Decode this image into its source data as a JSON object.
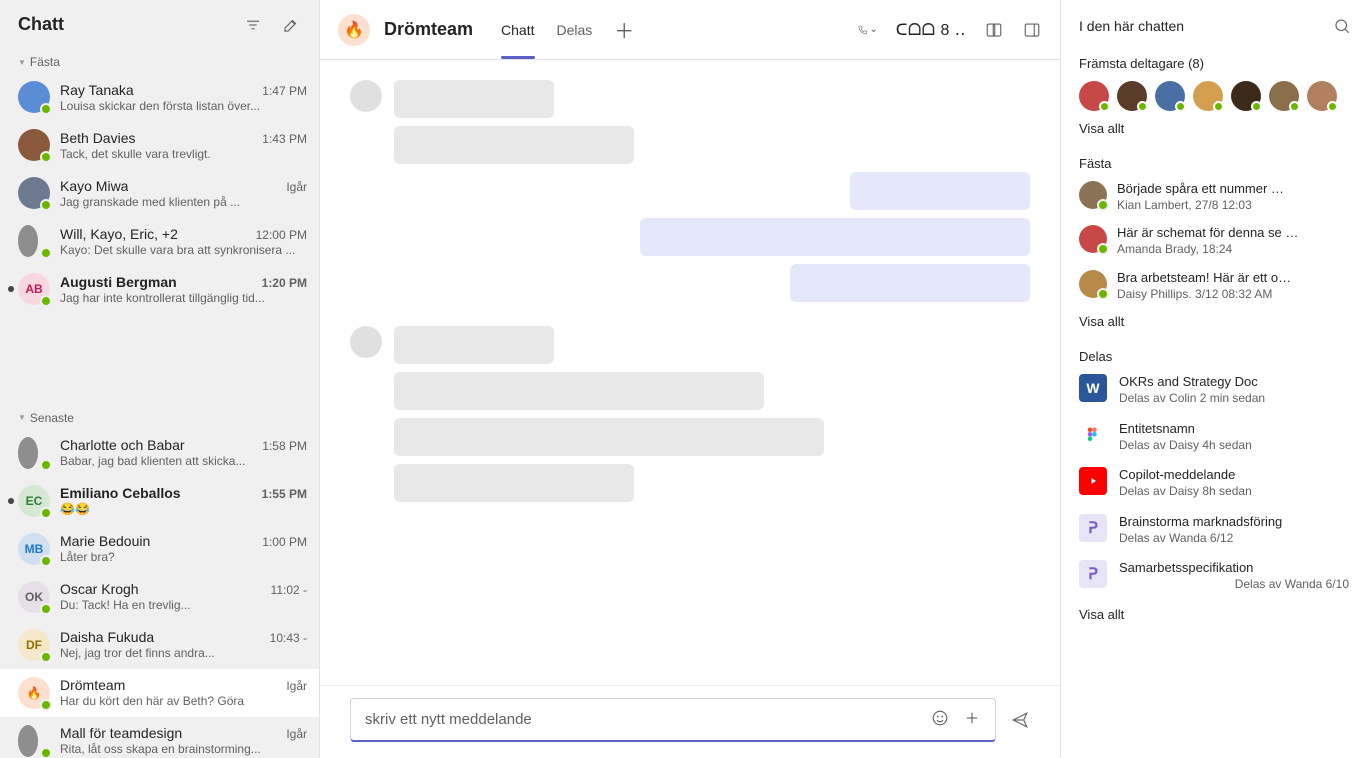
{
  "sidebar": {
    "title": "Chatt",
    "sections": {
      "pinned": "Fästa",
      "recent": "Senaste"
    }
  },
  "chats": [
    {
      "name": "Ray Tanaka",
      "time": "1:47 PM",
      "preview": "Louisa skickar den första listan över...",
      "avatar_bg": "#5b8dd6"
    },
    {
      "name": "Beth  Davies",
      "time": "1:43 PM",
      "preview": "Tack, det skulle vara trevligt.",
      "avatar_bg": "#8b5a3c"
    },
    {
      "name": "Kayo Miwa",
      "time": "Igår",
      "preview": "Jag granskade med klienten på ...",
      "avatar_bg": "#6b7a8f"
    },
    {
      "name": "Will, Kayo, Eric, +2",
      "time": "12:00 PM",
      "preview": "Kayo: Det skulle vara bra att synkronisera ...",
      "dual": true
    },
    {
      "name": "Augusti Bergman",
      "time": "1:20 PM",
      "preview": "Jag har inte kontrollerat tillgänglig tid...",
      "avatar_bg": "#f7d8e0",
      "initials": "AB",
      "text_color": "#c2185b",
      "unread": true
    },
    {
      "name": "Charlotte och    Babar",
      "time": "1:58 PM",
      "preview": "Babar, jag bad klienten att skicka...",
      "dual": true
    },
    {
      "name": "Emiliano Ceballos",
      "time": "1:55 PM",
      "preview": "😂😂",
      "avatar_bg": "#d4e8d4",
      "initials": "EC",
      "text_color": "#2e7d32",
      "unread": true
    },
    {
      "name": "Marie Bedouin",
      "time": "1:00 PM",
      "preview": "Låter bra?",
      "avatar_bg": "#d0e0f0",
      "initials": "MB",
      "text_color": "#1976d2"
    },
    {
      "name": "Oscar Krogh",
      "time": "11:02 ‑",
      "preview": "Du: Tack! Ha en trevlig...",
      "avatar_bg": "#e8e0e8",
      "initials": "OK",
      "text_color": "#616161"
    },
    {
      "name": "Daisha Fukuda",
      "time": "10:43 ‑",
      "preview": "Nej, jag tror det finns andra...",
      "avatar_bg": "#f5e8c8",
      "initials": "DF",
      "text_color": "#8d6e00"
    },
    {
      "name": "Drömteam",
      "time": "Igår",
      "preview": "Har du kört den här av Beth? Göra",
      "avatar_bg": "#ffe0d0",
      "emoji": "🔥",
      "selected": true
    },
    {
      "name": "Mall för teamdesign",
      "time": "Igår",
      "preview": "Rita, låt oss skapa en brainstorming...",
      "dual": true
    }
  ],
  "header": {
    "chat_name": "Drömteam",
    "emoji": "🔥",
    "tabs": {
      "chat": "Chatt",
      "shared": "Delas"
    },
    "people_label": "ᑕᗝᗝ 8 ‥"
  },
  "messages": {
    "left1": [
      160,
      240
    ],
    "right1": [
      180,
      390,
      240
    ],
    "left2": [
      160,
      370,
      430,
      240
    ]
  },
  "composer": {
    "placeholder": "skriv ett nytt meddelande"
  },
  "right_panel": {
    "title": "I den här chatten",
    "participants_label": "Främsta deltagare (8)",
    "show_all": "Visa allt",
    "pinned_label": "Fästa",
    "pinned": [
      {
        "title": "Började spåra ett nummer …",
        "meta": "Kian Lambert, 27/8 12:03",
        "bg": "#8b7355"
      },
      {
        "title": "Här är schemat för denna se …",
        "meta": "Amanda Brady, 18:24",
        "bg": "#c84848"
      },
      {
        "title": "Bra arbetsteam!      Här är ett o…",
        "meta": "Daisy Phillips. 3/12 08:32 AM",
        "bg": "#b88a4a"
      }
    ],
    "shared_label": "Delas",
    "shared": [
      {
        "title": "OKRs and Strategy Doc",
        "meta": "Delas av Colin 2 min sedan",
        "icon_bg": "#2b579a",
        "icon_text": "W"
      },
      {
        "title": "Entitetsnamn",
        "meta": "Delas av Daisy 4h sedan",
        "icon_bg": "#fff",
        "figma": true
      },
      {
        "title": "Copilot-meddelande",
        "meta": "Delas av Daisy 8h sedan",
        "icon_bg": "#ff0000",
        "youtube": true
      },
      {
        "title": "Brainstorma marknadsföring",
        "meta": "Delas av Wanda 6/12",
        "icon_bg": "#e8e4f8",
        "loop_text": "ᕈ",
        "loop_color": "#7b5dc7"
      },
      {
        "title": "Samarbetsspecifikation",
        "meta": "Delas av Wanda 6/10",
        "icon_bg": "#e8e4f8",
        "loop_text": "ᕈ",
        "loop_color": "#7b5dc7",
        "meta_right": true
      }
    ],
    "participant_colors": [
      "#c84848",
      "#5a3c2b",
      "#4a6fa5",
      "#d4a050",
      "#3c2b1a",
      "#8b6f4a",
      "#b08060"
    ]
  }
}
